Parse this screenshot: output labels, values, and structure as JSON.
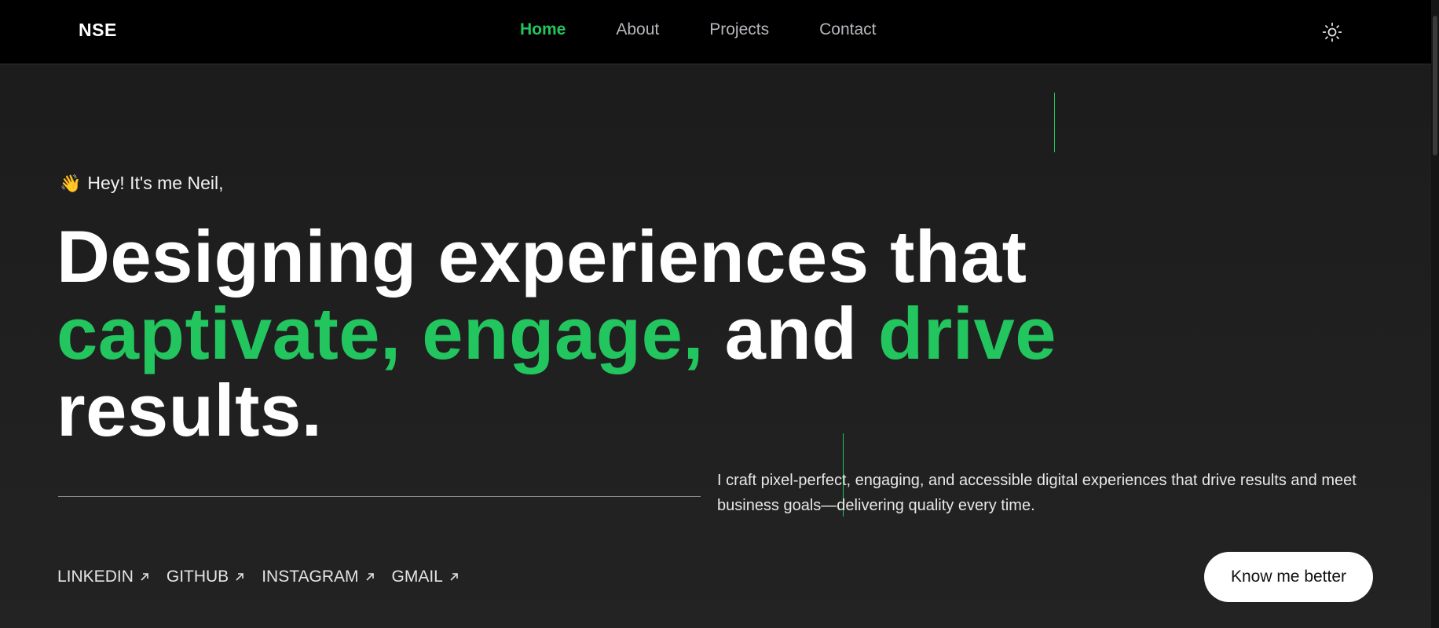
{
  "nav": {
    "brand": "NSE",
    "links": [
      {
        "label": "Home",
        "active": true
      },
      {
        "label": "About",
        "active": false
      },
      {
        "label": "Projects",
        "active": false
      },
      {
        "label": "Contact",
        "active": false
      }
    ],
    "theme_icon": "sun-icon"
  },
  "hero": {
    "greeting_emoji": "👋",
    "greeting": "Hey! It's me Neil,",
    "headline": {
      "w1": "Designing",
      "w2": "experiences",
      "w3": "that",
      "w4": "captivate,",
      "w5": "engage,",
      "w6": "and",
      "w7": "drive",
      "w8": "results."
    },
    "description": "I craft pixel-perfect, engaging, and accessible digital experiences that drive results and meet business goals—delivering quality every time.",
    "socials": [
      "LINKEDIN",
      "GITHUB",
      "INSTAGRAM",
      "GMAIL"
    ],
    "cta_label": "Know me better"
  },
  "colors": {
    "accent": "#22c55e",
    "background": "#1d1d1d",
    "navbar": "#000000",
    "text": "#ffffff"
  }
}
